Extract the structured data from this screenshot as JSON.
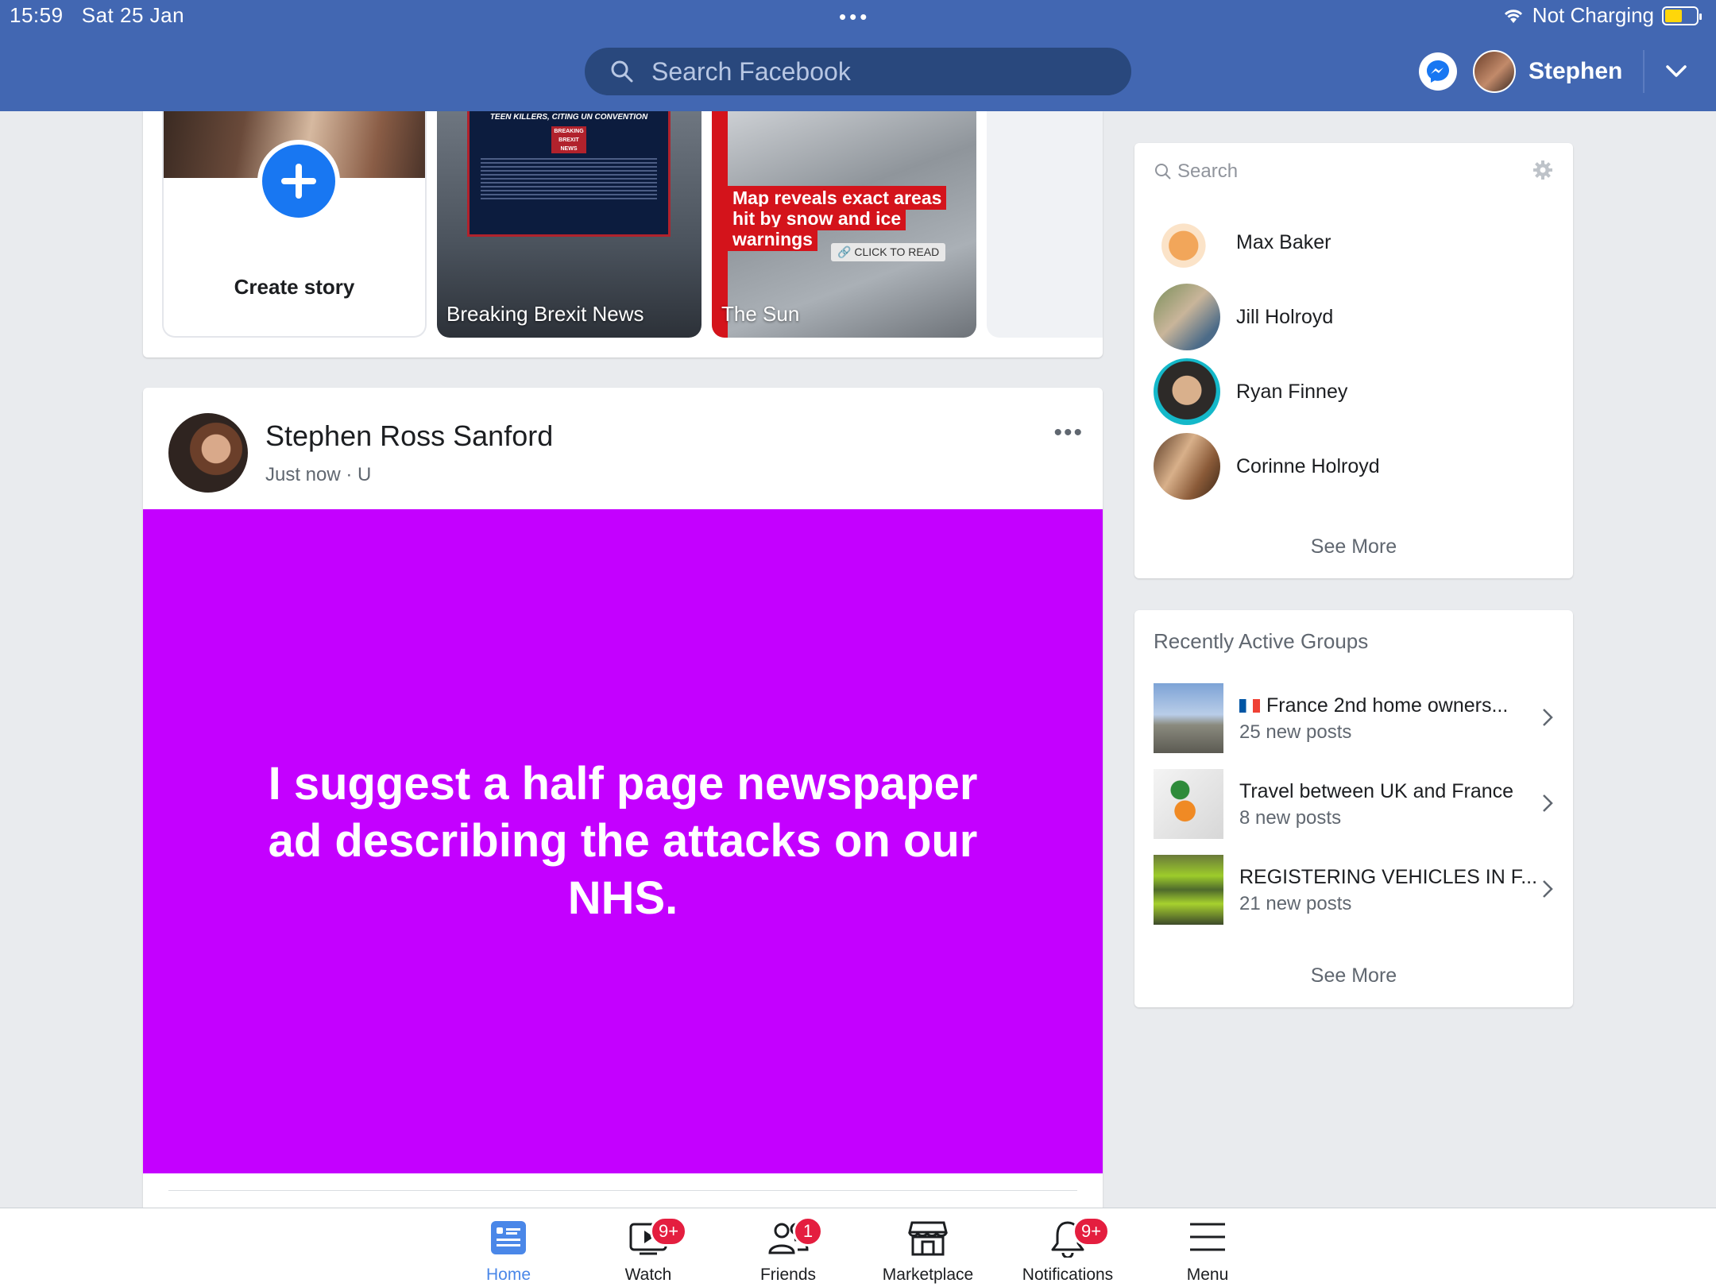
{
  "status": {
    "time": "15:59",
    "date": "Sat 25 Jan",
    "charging": "Not Charging",
    "battery_level": 0.55
  },
  "header": {
    "search_placeholder": "Search Facebook",
    "user_name": "Stephen"
  },
  "stories": {
    "create_label": "Create story",
    "items": [
      {
        "label": "Breaking Brexit News",
        "headline": "TEEN KILLERS, CITING UN CONVENTION",
        "logo": "BREAKING BREXIT NEWS"
      },
      {
        "label": "The Sun",
        "headline": "Map reveals exact areas hit by snow and ice warnings",
        "cta": "CLICK TO READ"
      }
    ]
  },
  "post": {
    "author": "Stephen Ross Sanford",
    "meta": "Just now · U",
    "text": "I suggest a half page newspaper ad describing the attacks on our NHS.",
    "background_color": "#c400ff"
  },
  "contacts": {
    "search_placeholder": "Search",
    "items": [
      {
        "name": "Max Baker"
      },
      {
        "name": "Jill Holroyd"
      },
      {
        "name": "Ryan Finney"
      },
      {
        "name": "Corinne Holroyd"
      }
    ],
    "see_more": "See More"
  },
  "groups": {
    "title": "Recently Active Groups",
    "items": [
      {
        "name": "France 2nd home owners...",
        "sub": "25 new posts"
      },
      {
        "name": "Travel between UK and France",
        "sub": "8 new posts"
      },
      {
        "name": "REGISTERING VEHICLES IN F...",
        "sub": "21 new posts"
      }
    ],
    "see_more": "See More"
  },
  "tabbar": {
    "items": [
      {
        "label": "Home",
        "icon": "home-feed-icon",
        "active": true
      },
      {
        "label": "Watch",
        "icon": "watch-video-icon",
        "badge": "9+"
      },
      {
        "label": "Friends",
        "icon": "friends-icon",
        "badge": "1"
      },
      {
        "label": "Marketplace",
        "icon": "marketplace-shop-icon"
      },
      {
        "label": "Notifications",
        "icon": "bell-icon",
        "badge": "9+"
      },
      {
        "label": "Menu",
        "icon": "hamburger-menu-icon"
      }
    ]
  },
  "colors": {
    "brand": "#4267b2",
    "badge": "#e41e3f",
    "active_tab": "#4a87e8"
  }
}
